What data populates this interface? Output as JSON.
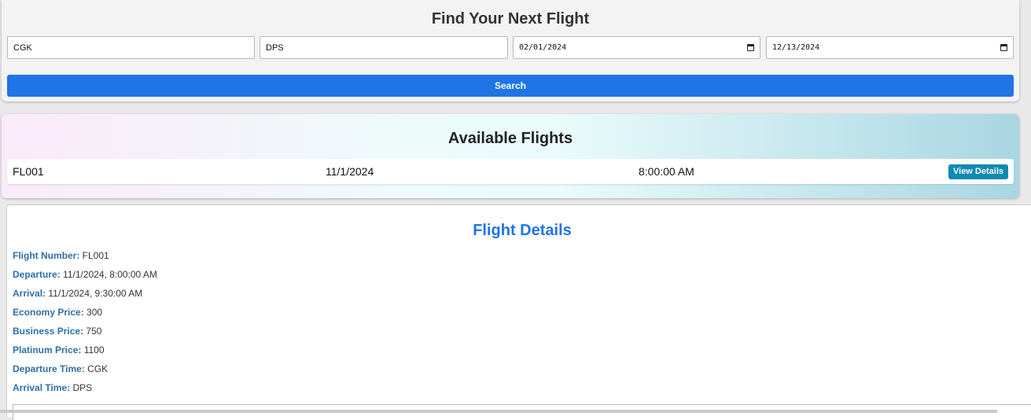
{
  "search": {
    "title": "Find Your Next Flight",
    "origin": "CGK",
    "destination": "DPS",
    "depart_date": "02/01/2024",
    "return_date": "12/13/2024",
    "button_label": "Search"
  },
  "flights": {
    "title": "Available Flights",
    "rows": [
      {
        "number": "FL001",
        "date": "11/1/2024",
        "time": "8:00:00 AM",
        "action": "View Details"
      }
    ]
  },
  "details": {
    "title": "Flight Details",
    "fields": [
      {
        "label": "Flight Number:",
        "value": "FL001"
      },
      {
        "label": "Departure:",
        "value": "11/1/2024, 8:00:00 AM"
      },
      {
        "label": "Arrival:",
        "value": "11/1/2024, 9:30:00 AM"
      },
      {
        "label": "Economy Price:",
        "value": "300"
      },
      {
        "label": "Business Price:",
        "value": "750"
      },
      {
        "label": "Platinum Price:",
        "value": "1100"
      },
      {
        "label": "Departure Time:",
        "value": "CGK"
      },
      {
        "label": "Arrival Time:",
        "value": "DPS"
      }
    ]
  },
  "colors": {
    "primary": "#1f74e6",
    "view_button": "#0d89b3",
    "label": "#2d6fa8"
  }
}
